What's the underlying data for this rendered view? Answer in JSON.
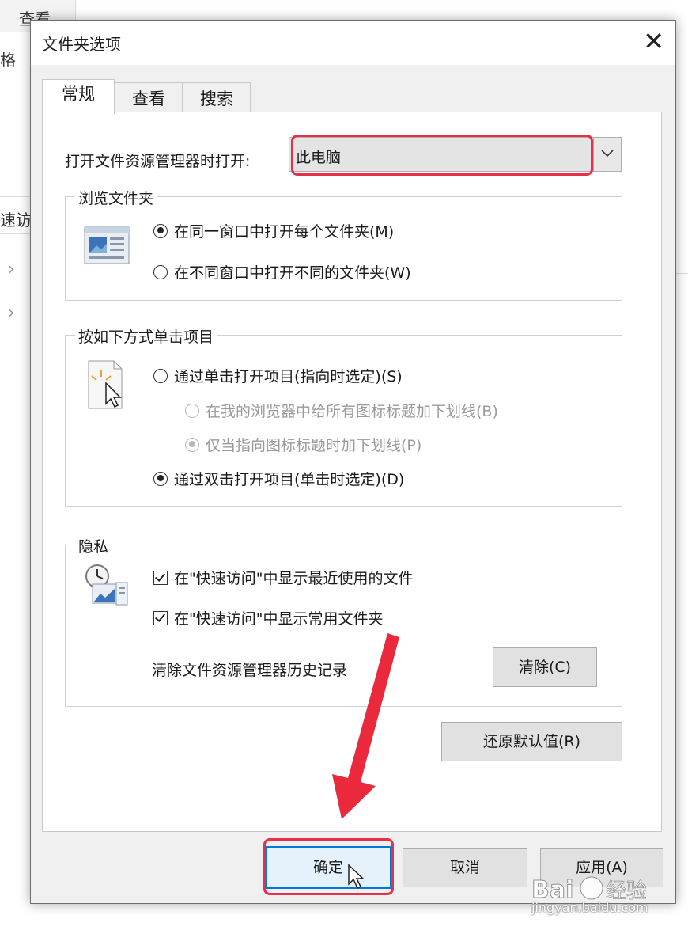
{
  "background_window": {
    "tab_label": "查看",
    "left_label_1": "格",
    "left_label_2": "速访",
    "chevron": "›"
  },
  "dialog": {
    "title": "文件夹选项",
    "close_glyph": "✕",
    "tabs": [
      {
        "label": "常规",
        "active": true
      },
      {
        "label": "查看",
        "active": false
      },
      {
        "label": "搜索",
        "active": false
      }
    ],
    "open_explorer": {
      "label": "打开文件资源管理器时打开:",
      "value": "此电脑"
    },
    "browse_folders": {
      "legend": "浏览文件夹",
      "options": [
        {
          "label": "在同一窗口中打开每个文件夹(M)",
          "selected": true
        },
        {
          "label": "在不同窗口中打开不同的文件夹(W)",
          "selected": false
        }
      ]
    },
    "click_items": {
      "legend": "按如下方式单击项目",
      "single_click": {
        "label": "通过单击打开项目(指向时选定)(S)",
        "selected": false
      },
      "underline_always": {
        "label": "在我的浏览器中给所有图标标题加下划线(B)",
        "selected": false,
        "disabled": true
      },
      "underline_hover": {
        "label": "仅当指向图标标题时加下划线(P)",
        "selected": true,
        "disabled": true
      },
      "double_click": {
        "label": "通过双击打开项目(单击时选定)(D)",
        "selected": true
      }
    },
    "privacy": {
      "legend": "隐私",
      "show_recent_files": {
        "label": "在\"快速访问\"中显示最近使用的文件",
        "checked": true
      },
      "show_frequent_folders": {
        "label": "在\"快速访问\"中显示常用文件夹",
        "checked": true
      },
      "clear_history_label": "清除文件资源管理器历史记录",
      "clear_button": "清除(C)"
    },
    "restore_defaults_button": "还原默认值(R)",
    "footer": {
      "ok_button": "确定",
      "cancel_button": "取消",
      "apply_button": "应用(A)"
    }
  },
  "annotations": {
    "highlight_color": "#e6304a",
    "watermark_text": "jingyan.baidu.com",
    "watermark_logo": "Bai du 经验"
  }
}
